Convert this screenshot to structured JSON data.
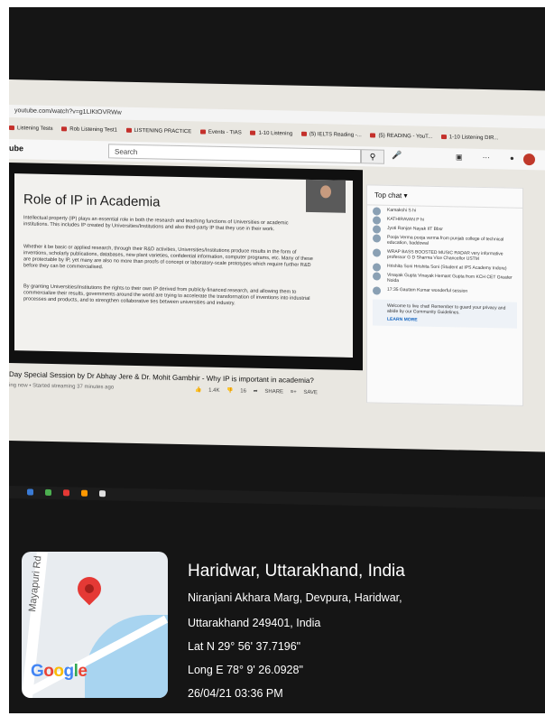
{
  "browser": {
    "url": "youtube.com/watch?v=g1LIKtOVRWw",
    "bookmarks": [
      "Listening Tests",
      "Rob Listening Test1",
      "LISTENING PRACTICE",
      "Events - TIAS",
      "1-10 Listening",
      "(5) IELTS Reading -...",
      "(5) READING - YouT...",
      "1-10 Listening DIR..."
    ]
  },
  "youtube": {
    "search_placeholder": "Search",
    "slide": {
      "title": "Role of IP in Academia",
      "paragraphs": [
        "Intellectual property (IP) plays an essential role in both the research and teaching functions of Universities or academic institutions. This includes IP created by Universities/Institutions and also third-party IP that they use in their work.",
        "Whether it be basic or applied research, through their R&D activities, Universities/Institutions produce results in the form of inventions, scholarly publications, databases, new plant varieties, confidential information, computer programs, etc. Many of these are protectable by IP, yet many are also no more than proofs of concept or laboratory-scale prototypes which require further R&D before they can be commercialised.",
        "By granting Universities/Institutions the rights to their own IP derived from publicly-financed research, and allowing them to commercialize their results, governments around the world are trying to accelerate the transformation of inventions into industrial processes and products, and to strengthen collaborative ties between universities and industry."
      ]
    },
    "chat": {
      "header": "Top chat",
      "messages": [
        "Kamakshi S  hi",
        "KATHIRAVAN P  hi",
        "Jyoti Ranjan Nayak  IIT Bbsr",
        "Pooja Verma  pooja verma from punjab college of technical education, baddowal",
        "WRAP BASS BOOSTED MUSIC RADAR  very informative  professor G D Sharma Vice Chancellor USTM",
        "Hrishita Soni  Hrishita Soni (Student at IPS Academy Indore)",
        "Vinayak Gupta  Vinayak Hemant Gupta from KCH CET Greater Noida",
        "17:35 Gautam Kumar  wonderful session"
      ],
      "welcome": "Welcome to live chat! Remember to guard your privacy and abide by our Community Guidelines.",
      "learn_more": "LEARN MORE"
    },
    "video_title": "Day Special Session by Dr Abhay Jere & Dr. Mohit Gambhir - Why IP is important in academia?",
    "video_meta": "ing now • Started streaming 37 minutes ago",
    "likes": "1.4K",
    "dislikes": "16",
    "share": "SHARE",
    "save": "SAVE"
  },
  "location": {
    "title": "Haridwar, Uttarakhand, India",
    "address_line1": "Niranjani Akhara Marg, Devpura, Haridwar,",
    "address_line2": "Uttarakhand 249401, India",
    "lat": "Lat N 29° 56' 37.7196\"",
    "long": "Long E 78° 9' 26.0928\"",
    "datetime": "26/04/21 03:36 PM",
    "map_road": "Mayapuri Rd",
    "map_logo": "Google"
  },
  "colors": {
    "accent_red": "#e53935",
    "yt_red": "#c4302b"
  }
}
